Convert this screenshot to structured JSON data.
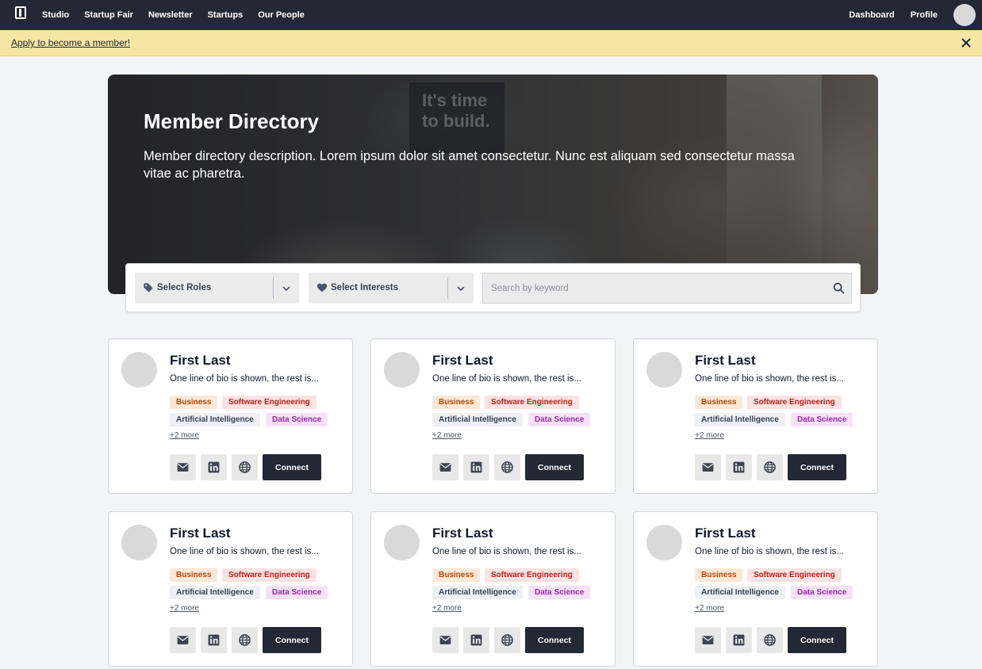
{
  "nav": {
    "links": [
      "Studio",
      "Startup Fair",
      "Newsletter",
      "Startups",
      "Our People"
    ],
    "right_links": [
      "Dashboard",
      "Profile"
    ]
  },
  "banner": {
    "text": "Apply to become a member!"
  },
  "hero": {
    "title": "Member Directory",
    "description": "Member directory description. Lorem ipsum dolor sit amet consectetur. Nunc est aliquam sed consectetur massa vitae ac pharetra.",
    "poster_text": "It's time to build."
  },
  "filters": {
    "roles_label": "Select Roles",
    "interests_label": "Select Interests",
    "search_placeholder": "Search by keyword"
  },
  "members": [
    {
      "name": "First Last",
      "bio": "One line of bio is shown, the rest is...",
      "tags": [
        "Business",
        "Software Engineering",
        "Artificial Intelligence",
        "Data Science"
      ],
      "more": "+2 more",
      "connect": "Connect"
    },
    {
      "name": "First Last",
      "bio": "One line of bio is shown, the rest is...",
      "tags": [
        "Business",
        "Software Engineering",
        "Artificial Intelligence",
        "Data Science"
      ],
      "more": "+2 more",
      "connect": "Connect"
    },
    {
      "name": "First Last",
      "bio": "One line of bio is shown, the rest is...",
      "tags": [
        "Business",
        "Software Engineering",
        "Artificial Intelligence",
        "Data Science"
      ],
      "more": "+2 more",
      "connect": "Connect"
    },
    {
      "name": "First Last",
      "bio": "One line of bio is shown, the rest is...",
      "tags": [
        "Business",
        "Software Engineering",
        "Artificial Intelligence",
        "Data Science"
      ],
      "more": "+2 more",
      "connect": "Connect"
    },
    {
      "name": "First Last",
      "bio": "One line of bio is shown, the rest is...",
      "tags": [
        "Business",
        "Software Engineering",
        "Artificial Intelligence",
        "Data Science"
      ],
      "more": "+2 more",
      "connect": "Connect"
    },
    {
      "name": "First Last",
      "bio": "One line of bio is shown, the rest is...",
      "tags": [
        "Business",
        "Software Engineering",
        "Artificial Intelligence",
        "Data Science"
      ],
      "more": "+2 more",
      "connect": "Connect"
    }
  ],
  "icons": [
    "logo-icon",
    "close-icon",
    "tag-icon",
    "heart-icon",
    "chevron-down-icon",
    "search-icon",
    "mail-icon",
    "linkedin-icon",
    "globe-icon"
  ],
  "colors": {
    "nav_bg": "#222834",
    "banner_bg": "#f5e6a3",
    "page_bg": "#f3f4f6",
    "connect_bg": "#222834"
  }
}
